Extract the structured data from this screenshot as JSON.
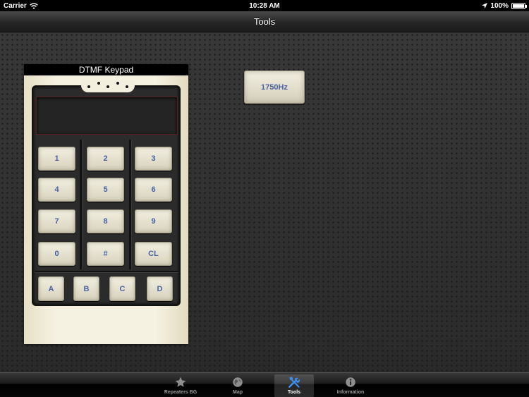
{
  "status_bar": {
    "carrier": "Carrier",
    "time": "10:28 AM",
    "battery": "100%",
    "battery_level": 1.0,
    "icons": [
      "wifi-icon",
      "location-arrow-icon",
      "battery-icon"
    ]
  },
  "nav": {
    "title": "Tools"
  },
  "dtmf": {
    "header": "DTMF Keypad",
    "display_value": "",
    "keys": [
      "1",
      "2",
      "3",
      "4",
      "5",
      "6",
      "7",
      "8",
      "9",
      "0",
      "#",
      "CL"
    ],
    "extra_keys": [
      "A",
      "B",
      "C",
      "D"
    ]
  },
  "tone_button": {
    "label": "1750Hz"
  },
  "tab_bar": {
    "tabs": [
      {
        "label": "Repeaters BG",
        "icon": "star-icon",
        "selected": false
      },
      {
        "label": "Map",
        "icon": "globe-icon",
        "selected": false
      },
      {
        "label": "Tools",
        "icon": "tools-icon",
        "selected": true
      },
      {
        "label": "Information",
        "icon": "info-icon",
        "selected": false
      }
    ]
  },
  "colors": {
    "key_text": "#4a62a4",
    "key_face": "#ede9d8",
    "panel_paper": "#f1ecd8",
    "selected_tab_icon": "#3d8ff2",
    "background": "#303030"
  }
}
